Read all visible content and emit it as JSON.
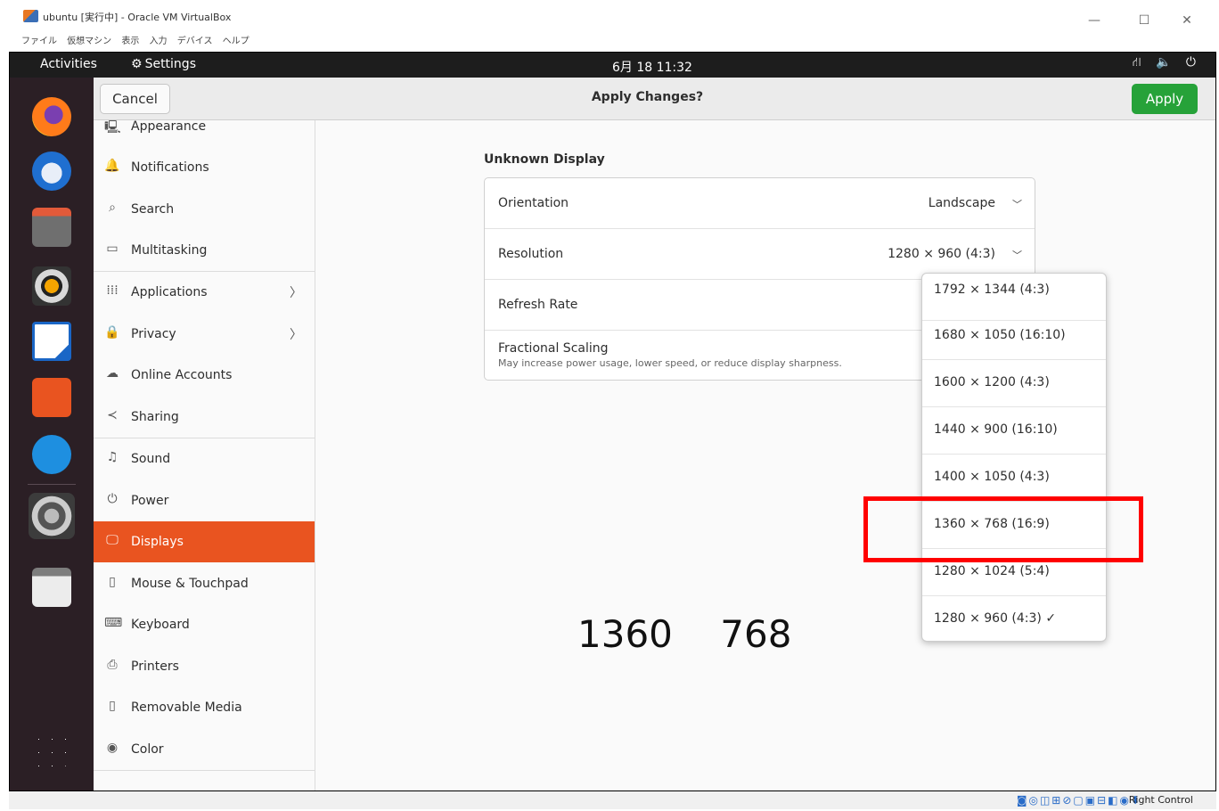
{
  "window": {
    "title": "ubuntu [実行中] - Oracle VM VirtualBox",
    "menu": [
      "ファイル",
      "仮想マシン",
      "表示",
      "入力",
      "デバイス",
      "ヘルプ"
    ],
    "controls": {
      "minimize": "—",
      "maximize": "☐",
      "close": "✕"
    }
  },
  "topbar": {
    "activities": "Activities",
    "app": "Settings",
    "clock": "6月 18 11:32",
    "tray": "⛙ 🔈 ⏻"
  },
  "dock": [
    "firefox-icon",
    "thunderbird-icon",
    "files-icon",
    "rhythmbox-icon",
    "writer-icon",
    "app-center-icon",
    "help-icon",
    "settings-icon",
    "trash-icon",
    "show-apps-icon"
  ],
  "header": {
    "cancel": "Cancel",
    "title": "Apply Changes?",
    "apply": "Apply"
  },
  "sidebar": [
    {
      "label": "Appearance",
      "icon": "🖳"
    },
    {
      "label": "Notifications",
      "icon": "🔔"
    },
    {
      "label": "Search",
      "icon": "⌕"
    },
    {
      "label": "Multitasking",
      "icon": "▭"
    },
    {
      "label": "Applications",
      "icon": "⁞⁞⁞",
      "chevron": "〉"
    },
    {
      "label": "Privacy",
      "icon": "🔒",
      "chevron": "〉"
    },
    {
      "label": "Online Accounts",
      "icon": "☁"
    },
    {
      "label": "Sharing",
      "icon": "≺"
    },
    {
      "label": "Sound",
      "icon": "♫"
    },
    {
      "label": "Power",
      "icon": "⏻"
    },
    {
      "label": "Displays",
      "icon": "🖵"
    },
    {
      "label": "Mouse & Touchpad",
      "icon": "▯"
    },
    {
      "label": "Keyboard",
      "icon": "⌨"
    },
    {
      "label": "Printers",
      "icon": "⎙"
    },
    {
      "label": "Removable Media",
      "icon": "▯"
    },
    {
      "label": "Color",
      "icon": "◉"
    }
  ],
  "display": {
    "name": "Unknown Display",
    "orientation_label": "Orientation",
    "orientation_value": "Landscape",
    "resolution_label": "Resolution",
    "resolution_value": "1280 × 960 (4:3)",
    "refresh_label": "Refresh Rate",
    "scaling_label": "Fractional Scaling",
    "scaling_desc": "May increase power usage, lower speed, or reduce display sharpness."
  },
  "resolution_options": [
    "1792 × 1344 (4:3)",
    "1680 × 1050 (16:10)",
    "1600 × 1200 (4:3)",
    "1440 × 900 (16:10)",
    "1400 × 1050 (4:3)",
    "1360 × 768 (16:9)",
    "1280 × 1024 (5:4)",
    "1280 × 960 (4:3) ✓"
  ],
  "annotation": "1360    768",
  "statusbar": {
    "icons": "◙◎◫⊞⊘▢▣⊟◧◉⬇",
    "host_key": "Right Control"
  },
  "colors": {
    "accent": "#e95420",
    "apply": "#26a239",
    "highlight": "#ff0000",
    "dock": "#2b1f25",
    "topbar": "#1d1d1d"
  }
}
